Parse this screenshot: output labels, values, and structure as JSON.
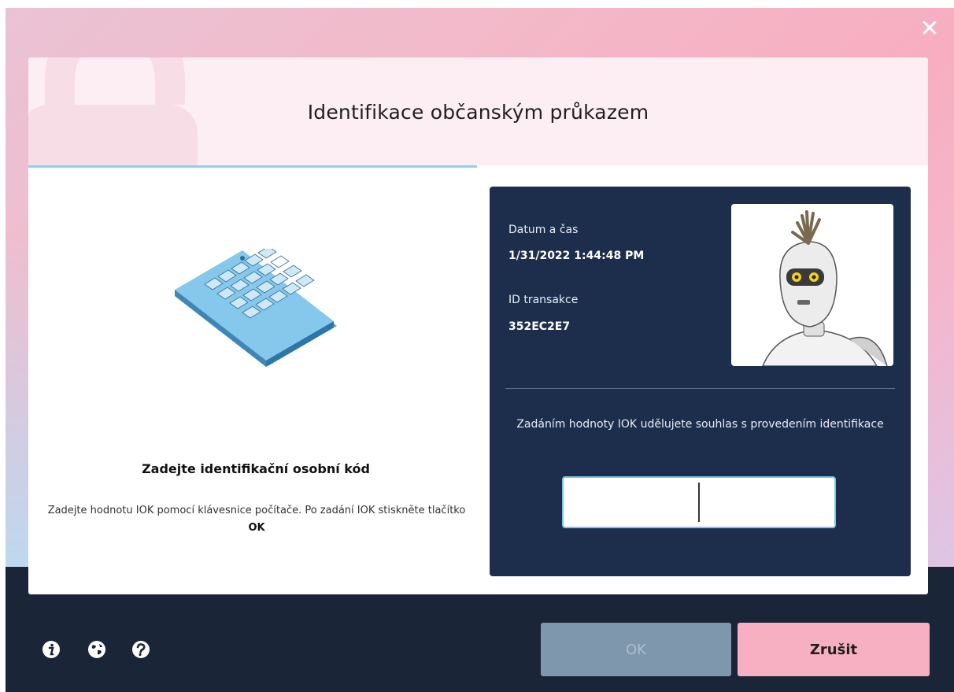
{
  "window": {
    "title": "Identifikace občanským průkazem",
    "close_label": "✕"
  },
  "left": {
    "instruction_title": "Zadejte identifikační osobní kód",
    "instruction_text_before": "Zadejte hodnotu IOK pomocí klávesnice počítače. Po zadání IOK stiskněte tlačítko ",
    "instruction_text_bold": "OK",
    "progress_fraction": 0.5
  },
  "info": {
    "datetime_label": "Datum a čas",
    "datetime_value": "1/31/2022 1:44:48 PM",
    "transaction_label": "ID transakce",
    "transaction_value": "352EC2E7",
    "consent_text": "Zadáním hodnoty IOK udělujete souhlas s provedením identifikace",
    "iok_input_value": ""
  },
  "footer": {
    "icons": [
      "info-icon",
      "globe-icon",
      "help-icon"
    ],
    "ok_label": "OK",
    "cancel_label": "Zrušit"
  },
  "colors": {
    "accent_blue": "#8ed1ef",
    "card_bg": "#1c2e4c",
    "footer_bg": "#1b2538",
    "ok_disabled": "#7f97ad",
    "cancel_pink": "#f7b0c2"
  }
}
